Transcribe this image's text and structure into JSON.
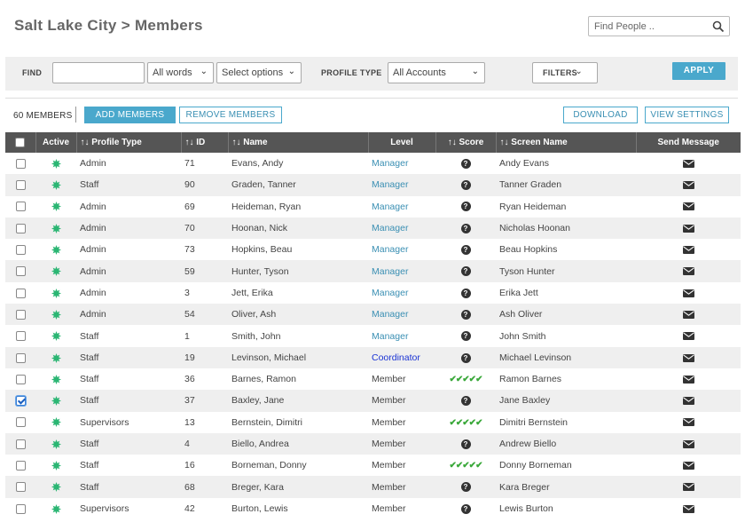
{
  "page": {
    "title": "Salt Lake City > Members",
    "search_placeholder": "Find People .."
  },
  "filterbar": {
    "find_label": "FIND",
    "words_select": "All words",
    "options_select": "Select options",
    "profile_type_label": "PROFILE TYPE",
    "accounts_select": "All Accounts",
    "filters_label": "FILTERS",
    "apply_label": "APPLY"
  },
  "toolbar": {
    "count": "60 MEMBERS",
    "add_members": "ADD MEMBERS",
    "remove_members": "REMOVE MEMBERS",
    "download": "DOWNLOAD",
    "view_settings": "VIEW SETTINGS"
  },
  "table": {
    "columns": {
      "active": "Active",
      "profile_type": "↑↓ Profile Type",
      "id": "↑↓ ID",
      "name": "↑↓ Name",
      "level": "Level",
      "score": "↑↓ Score",
      "screen_name": "↑↓ Screen Name",
      "send_message": "Send Message"
    },
    "rows": [
      {
        "checked": false,
        "profile_type": "Admin",
        "id": "71",
        "name": "Evans, Andy",
        "level": "Manager",
        "level_style": "link",
        "score": "unknown",
        "screen_name": "Andy Evans"
      },
      {
        "checked": false,
        "profile_type": "Staff",
        "id": "90",
        "name": "Graden, Tanner",
        "level": "Manager",
        "level_style": "link",
        "score": "unknown",
        "screen_name": "Tanner Graden"
      },
      {
        "checked": false,
        "profile_type": "Admin",
        "id": "69",
        "name": "Heideman, Ryan",
        "level": "Manager",
        "level_style": "link",
        "score": "unknown",
        "screen_name": "Ryan Heideman"
      },
      {
        "checked": false,
        "profile_type": "Admin",
        "id": "70",
        "name": "Hoonan, Nick",
        "level": "Manager",
        "level_style": "link",
        "score": "unknown",
        "screen_name": "Nicholas Hoonan"
      },
      {
        "checked": false,
        "profile_type": "Admin",
        "id": "73",
        "name": "Hopkins, Beau",
        "level": "Manager",
        "level_style": "link",
        "score": "unknown",
        "screen_name": "Beau Hopkins"
      },
      {
        "checked": false,
        "profile_type": "Admin",
        "id": "59",
        "name": "Hunter, Tyson",
        "level": "Manager",
        "level_style": "link",
        "score": "unknown",
        "screen_name": "Tyson Hunter"
      },
      {
        "checked": false,
        "profile_type": "Admin",
        "id": "3",
        "name": "Jett, Erika",
        "level": "Manager",
        "level_style": "link",
        "score": "unknown",
        "screen_name": "Erika Jett"
      },
      {
        "checked": false,
        "profile_type": "Admin",
        "id": "54",
        "name": "Oliver, Ash",
        "level": "Manager",
        "level_style": "link",
        "score": "unknown",
        "screen_name": "Ash Oliver"
      },
      {
        "checked": false,
        "profile_type": "Staff",
        "id": "1",
        "name": "Smith, John",
        "level": "Manager",
        "level_style": "link",
        "score": "unknown",
        "screen_name": "John Smith"
      },
      {
        "checked": false,
        "profile_type": "Staff",
        "id": "19",
        "name": "Levinson, Michael",
        "level": "Coordinator",
        "level_style": "coord",
        "score": "unknown",
        "screen_name": "Michael Levinson"
      },
      {
        "checked": false,
        "profile_type": "Staff",
        "id": "36",
        "name": "Barnes, Ramon",
        "level": "Member",
        "level_style": "plain",
        "score": "checks",
        "screen_name": "Ramon Barnes"
      },
      {
        "checked": true,
        "profile_type": "Staff",
        "id": "37",
        "name": "Baxley, Jane",
        "level": "Member",
        "level_style": "plain",
        "score": "unknown",
        "screen_name": "Jane Baxley"
      },
      {
        "checked": false,
        "profile_type": "Supervisors",
        "id": "13",
        "name": "Bernstein, Dimitri",
        "level": "Member",
        "level_style": "plain",
        "score": "checks",
        "screen_name": "Dimitri Bernstein"
      },
      {
        "checked": false,
        "profile_type": "Staff",
        "id": "4",
        "name": "Biello, Andrea",
        "level": "Member",
        "level_style": "plain",
        "score": "unknown",
        "screen_name": "Andrew Biello"
      },
      {
        "checked": false,
        "profile_type": "Staff",
        "id": "16",
        "name": "Borneman, Donny",
        "level": "Member",
        "level_style": "plain",
        "score": "checks",
        "screen_name": "Donny Borneman"
      },
      {
        "checked": false,
        "profile_type": "Staff",
        "id": "68",
        "name": "Breger, Kara",
        "level": "Member",
        "level_style": "plain",
        "score": "unknown",
        "screen_name": "Kara Breger"
      },
      {
        "checked": false,
        "profile_type": "Supervisors",
        "id": "42",
        "name": "Burton, Lewis",
        "level": "Member",
        "level_style": "plain",
        "score": "unknown",
        "screen_name": "Lewis Burton"
      }
    ]
  },
  "icons": {
    "active": "active-burst-icon",
    "score_unknown": "question-circle-icon",
    "score_checks": "checkmarks-icon",
    "message": "envelope-icon",
    "search": "search-icon"
  },
  "colors": {
    "accent": "#4aa8cc",
    "active_green": "#2bb673",
    "header_bg": "#555555",
    "coordinator": "#1a33d4",
    "check_green": "#3aa83a"
  }
}
